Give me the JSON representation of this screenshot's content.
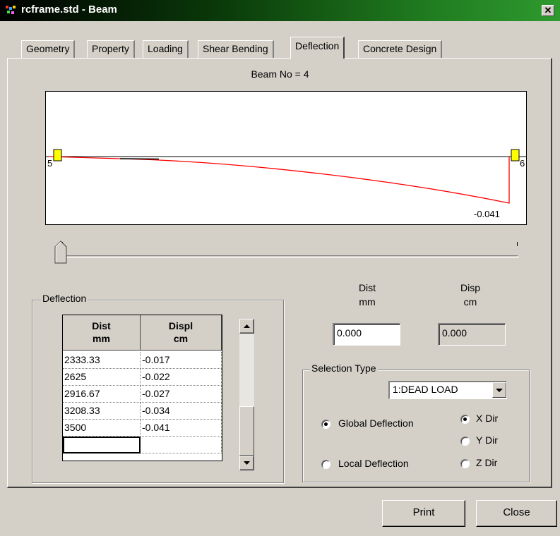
{
  "window": {
    "title": "rcframe.std - Beam",
    "close_glyph": "✕"
  },
  "tabs": [
    {
      "label": "Geometry"
    },
    {
      "label": "Property"
    },
    {
      "label": "Loading"
    },
    {
      "label": "Shear Bending"
    },
    {
      "label": "Deflection",
      "active": true
    },
    {
      "label": "Concrete Design"
    }
  ],
  "diagram": {
    "beam_title": "Beam No = 4",
    "start_node": "5",
    "end_node": "6",
    "max_label": "-0.041",
    "line_color": "#ff0000",
    "support_color": "#ffff00"
  },
  "deflection_table": {
    "group_label": "Deflection",
    "headers": [
      {
        "line1": "Dist",
        "line2": "mm"
      },
      {
        "line1": "Displ",
        "line2": "cm"
      }
    ],
    "rows": [
      {
        "dist": "2333.33",
        "displ": "-0.017"
      },
      {
        "dist": "2625",
        "displ": "-0.022"
      },
      {
        "dist": "2916.67",
        "displ": "-0.027"
      },
      {
        "dist": "3208.33",
        "displ": "-0.034"
      },
      {
        "dist": "3500",
        "displ": "-0.041"
      }
    ]
  },
  "readout": {
    "dist_label": "Dist",
    "dist_unit": "mm",
    "disp_label": "Disp",
    "disp_unit": "cm",
    "dist_value": "0.000",
    "disp_value": "0.000"
  },
  "selection": {
    "group_label": "Selection Type",
    "load_case": "1:DEAD LOAD",
    "global_deflection": "Global Deflection",
    "local_deflection": "Local Deflection",
    "x_dir": "X Dir",
    "y_dir": "Y Dir",
    "z_dir": "Z Dir",
    "selected_mode": "Global Deflection",
    "selected_dir": "X Dir"
  },
  "buttons": {
    "print": "Print",
    "close": "Close"
  }
}
